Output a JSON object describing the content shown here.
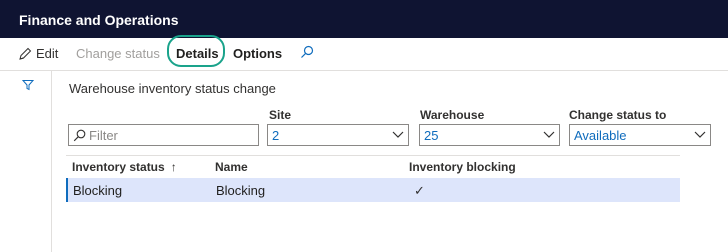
{
  "app": {
    "title": "Finance and Operations"
  },
  "actions": {
    "edit": "Edit",
    "change_status": "Change status",
    "details": "Details",
    "options": "Options"
  },
  "page": {
    "title": "Warehouse inventory status change"
  },
  "filters": {
    "filter_placeholder": "Filter",
    "site": {
      "label": "Site",
      "value": "2"
    },
    "warehouse": {
      "label": "Warehouse",
      "value": "25"
    },
    "change_status_to": {
      "label": "Change status to",
      "value": "Available"
    }
  },
  "grid": {
    "columns": [
      "Inventory status",
      "Name",
      "Inventory blocking"
    ],
    "sort_indicator": "↑",
    "rows": [
      {
        "inventory_status": "Blocking",
        "name": "Blocking",
        "inventory_blocking": "✓"
      }
    ]
  },
  "colors": {
    "header_bg": "#0f1432",
    "highlight_ring": "#1aa38b",
    "selected_row": "#dde5fb",
    "link_value": "#0f6cbd"
  }
}
